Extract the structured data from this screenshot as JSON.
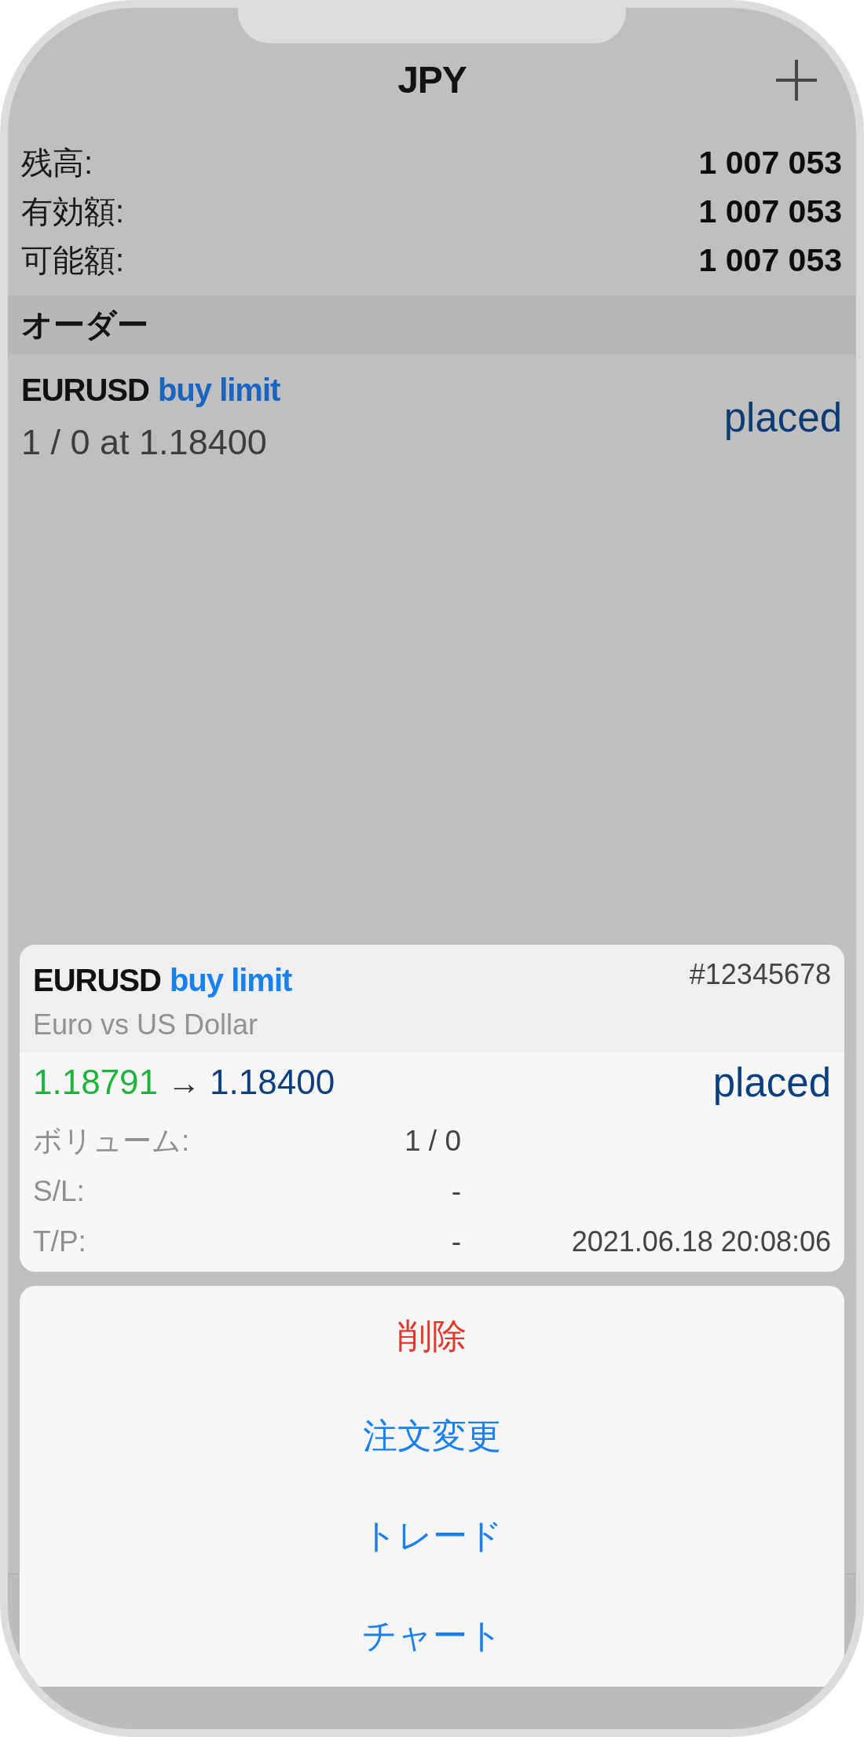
{
  "header": {
    "title": "JPY"
  },
  "account": [
    {
      "label": "残高:",
      "value": "1 007 053"
    },
    {
      "label": "有効額:",
      "value": "1 007 053"
    },
    {
      "label": "可能額:",
      "value": "1 007 053"
    }
  ],
  "section": {
    "title": "オーダー"
  },
  "orders": [
    {
      "symbol": "EURUSD",
      "type": "buy limit",
      "details": "1 / 0 at 1.18400",
      "status": "placed"
    }
  ],
  "order_card": {
    "symbol": "EURUSD",
    "type": "buy limit",
    "ticket": "#12345678",
    "description": "Euro vs US Dollar",
    "open_price": "1.18791",
    "arrow": "→",
    "price": "1.18400",
    "status": "placed",
    "fields": [
      {
        "label": "ボリューム:",
        "value": "1 / 0"
      },
      {
        "label": "S/L:",
        "value": "-"
      },
      {
        "label": "T/P:",
        "value": "-",
        "time": "2021.06.18 20:08:06"
      }
    ]
  },
  "actions": [
    {
      "label": "削除",
      "kind": "destructive"
    },
    {
      "label": "注文変更",
      "kind": "default"
    },
    {
      "label": "トレード",
      "kind": "default"
    },
    {
      "label": "チャート",
      "kind": "default"
    }
  ]
}
